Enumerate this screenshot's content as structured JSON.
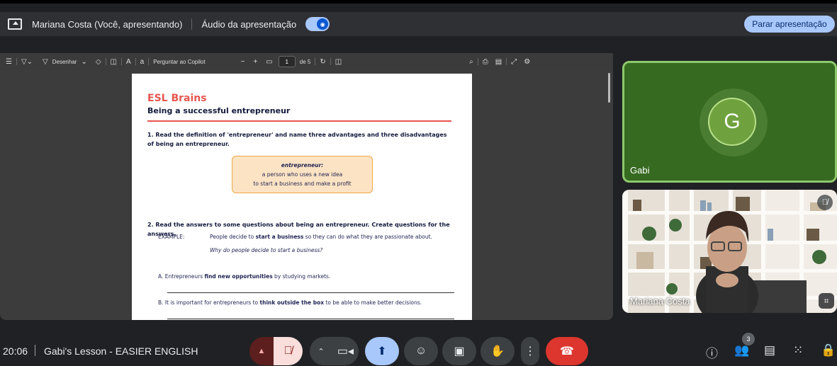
{
  "presenting_bar": {
    "presenter_text": "Mariana Costa (Você, apresentando)",
    "audio_label": "Áudio da apresentação",
    "audio_enabled": true,
    "stop_button": "Parar apresentação"
  },
  "pdf_toolbar": {
    "draw_label": "Desenhar",
    "copilot_label": "Perguntar ao Copilot",
    "page_number": "1",
    "page_total": "de 5"
  },
  "document": {
    "brand": "ESL Brains",
    "title": "Being a successful entrepreneur",
    "q1": "1.  Read the definition of 'entrepreneur' and name three advantages and three disadvantages of being an entrepreneur.",
    "definition": {
      "term": "entrepreneur:",
      "line1": "a person who uses a new idea",
      "line2": "to start a business and make a profit"
    },
    "q2": "2.  Read the answers to some questions about being an entrepreneur. Create questions for the answers.",
    "example_label": "EXAMPLE:",
    "example_pre": "People decide to ",
    "example_bold": "start a business",
    "example_post": " so they can do what they are passionate about.",
    "example_question": "Why do people decide to start a business?",
    "a_pre": "A.  Entrepreneurs ",
    "a_bold": "find new opportunities",
    "a_post": " by studying markets.",
    "b_pre": "B.  It is important for entrepreneurs to ",
    "b_bold": "think outside the box",
    "b_post": " to be able to make better decisions."
  },
  "tiles": {
    "gabi": {
      "name": "Gabi",
      "initial": "G"
    },
    "mariana": {
      "name": "Mariana Costa"
    }
  },
  "bottom_bar": {
    "time": "20:06",
    "meeting_name": "Gabi's Lesson - EASIER ENGLISH",
    "participants_count": "3"
  },
  "colors": {
    "accent": "#a8c7fa",
    "end_call": "#dc362e",
    "brand_red": "#e6574f",
    "gabi_tile": "#366a20"
  }
}
